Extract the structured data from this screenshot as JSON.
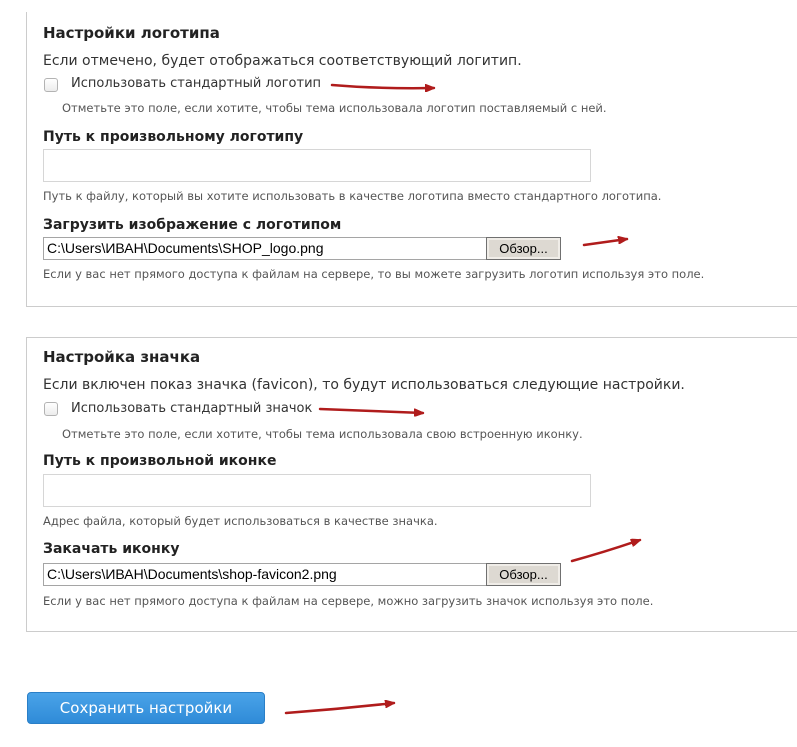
{
  "logo": {
    "legend": "Настройки логотипа",
    "intro": "Если отмечено, будет отображаться соответствующий логитип.",
    "default_checkbox_label": "Использовать стандартный логотип",
    "default_checkbox_checked": false,
    "default_checkbox_desc": "Отметьте это поле, если хотите, чтобы тема использовала логотип поставляемый с ней.",
    "path_label": "Путь к произвольному логотипу",
    "path_value": "",
    "path_desc": "Путь к файлу, который вы хотите использовать в качестве логотипа вместо стандартного логотипа.",
    "upload_label": "Загрузить изображение с логотипом",
    "upload_value": "C:\\Users\\ИВАН\\Documents\\SHOP_logo.png",
    "upload_button": "Обзор...",
    "upload_desc": "Если у вас нет прямого доступа к файлам на сервере, то вы можете загрузить логотип используя это поле."
  },
  "icon": {
    "legend": "Настройка значка",
    "intro": "Если включен показ значка (favicon), то будут использоваться следующие настройки.",
    "default_checkbox_label": "Использовать стандартный значок",
    "default_checkbox_checked": false,
    "default_checkbox_desc": "Отметьте это поле, если хотите, чтобы тема использовала свою встроенную иконку.",
    "path_label": "Путь к произвольной иконке",
    "path_value": "",
    "path_desc": "Адрес файла, который будет использоваться в качестве значка.",
    "upload_label": "Закачать иконку",
    "upload_value": "C:\\Users\\ИВАН\\Documents\\shop-favicon2.png",
    "upload_button": "Обзор...",
    "upload_desc": "Если у вас нет прямого доступа к файлам на сервере, можно загрузить значок используя это поле."
  },
  "save_button": "Сохранить настройки",
  "colors": {
    "annotation_arrow": "#b01c1c",
    "save_button": "#3a96e0"
  },
  "annotations": {
    "arrow_icon": "red-arrow-icon"
  }
}
